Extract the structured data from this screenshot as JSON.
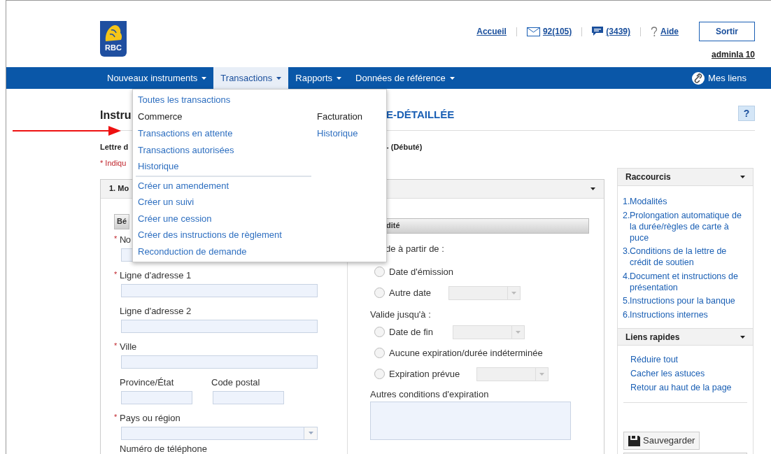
{
  "header": {
    "logo": "RBC",
    "links": [
      {
        "kind": "text",
        "label": "Accueil"
      },
      {
        "kind": "mail",
        "label": "92(105)"
      },
      {
        "kind": "chat",
        "label": "(3439)"
      },
      {
        "kind": "help",
        "label": "Aide"
      }
    ],
    "logout": "Sortir",
    "user": "adminla 10"
  },
  "nav": {
    "items": [
      {
        "label": "Nouveaux instruments",
        "selected": false
      },
      {
        "label": "Transactions",
        "selected": true
      },
      {
        "label": "Rapports",
        "selected": false
      },
      {
        "label": "Données de référence",
        "selected": false
      }
    ],
    "my_links": "Mes liens"
  },
  "dropdown": {
    "top_link": "Toutes les transactions",
    "columns": [
      [
        {
          "kind": "heading",
          "label": "Commerce"
        },
        {
          "kind": "link",
          "label": "Transactions en attente"
        },
        {
          "kind": "link",
          "label": "Transactions autorisées"
        },
        {
          "kind": "link",
          "label": "Historique"
        },
        {
          "kind": "divider"
        },
        {
          "kind": "link",
          "label": "Créer un amendement"
        },
        {
          "kind": "link",
          "label": "Créer un suivi"
        },
        {
          "kind": "link",
          "label": "Créer une cession"
        },
        {
          "kind": "link",
          "label": "Créer des instructions de règlement"
        },
        {
          "kind": "link",
          "label": "Reconduction de demande"
        }
      ],
      [
        {
          "kind": "heading",
          "label": "Facturation"
        },
        {
          "kind": "link",
          "label": "Historique"
        }
      ]
    ]
  },
  "page": {
    "title_start": "Instru",
    "title_end": "E-DÉTAILLÉE",
    "help": "?",
    "subtitle_start": "Lettre d",
    "subtitle_end": "- (Débuté)",
    "required_note": "* Indiqu"
  },
  "section": {
    "title": "1. Mo",
    "left_header": "Bé",
    "right_header": "dité",
    "left_fields": [
      {
        "kind": "select",
        "mark": "*",
        "label": "No"
      },
      {
        "kind": "text",
        "mark": "*",
        "label": "Ligne d'adresse 1"
      },
      {
        "kind": "text",
        "label": "Ligne d'adresse 2"
      },
      {
        "kind": "text",
        "mark": "*",
        "label": "Ville"
      },
      {
        "kind": "pair",
        "fields": [
          {
            "label": "Province/État"
          },
          {
            "label": "Code postal"
          }
        ]
      },
      {
        "kind": "select",
        "mark": "*",
        "label": "Pays ou région"
      },
      {
        "kind": "label",
        "label": "Numéro de téléphone"
      }
    ],
    "valid_from_label": "de à partir de :",
    "valid_from": [
      {
        "kind": "radio",
        "label": "Date d'émission",
        "selected": false
      },
      {
        "kind": "radio_select",
        "label": "Autre date",
        "selected": false
      }
    ],
    "valid_until_label": "Valide jusqu'à :",
    "valid_until": [
      {
        "kind": "radio_select",
        "label": "Date de fin",
        "selected": false
      },
      {
        "kind": "radio",
        "label": "Aucune expiration/durée indéterminée",
        "selected": false
      },
      {
        "kind": "radio_select",
        "label": "Expiration prévue",
        "selected": false
      }
    ],
    "other_label": "Autres conditions d'expiration"
  },
  "sidebar": {
    "shortcuts_title": "Raccourcis",
    "shortcuts": [
      {
        "number": "1.",
        "label": "Modalités"
      },
      {
        "number": "2.",
        "label": "Prolongation automatique de la durée/règles de carte à puce"
      },
      {
        "number": "3.",
        "label": "Conditions de la lettre de crédit de soutien"
      },
      {
        "number": "4.",
        "label": "Document et instructions de présentation"
      },
      {
        "number": "5.",
        "label": "Instructions pour la banque"
      },
      {
        "number": "6.",
        "label": "Instructions internes"
      }
    ],
    "quick_title": "Liens rapides",
    "quick_links": [
      "Réduire tout",
      "Cacher les astuces",
      "Retour au haut de la page"
    ],
    "save": "Sauvegarder"
  }
}
